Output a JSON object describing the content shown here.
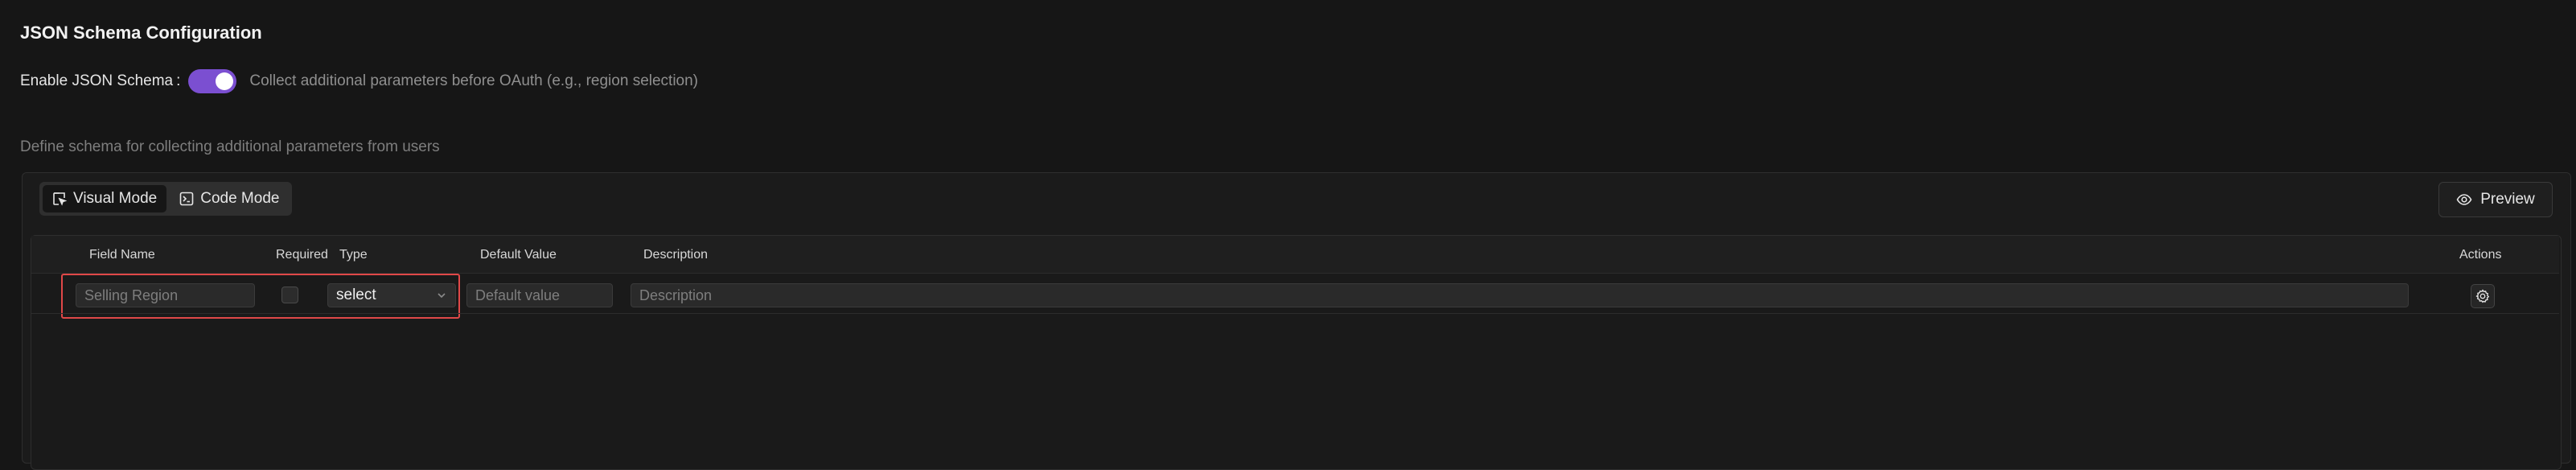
{
  "section": {
    "title": "JSON Schema Configuration",
    "enable_label": "Enable JSON Schema",
    "enable_colon": ":",
    "enable_on": true,
    "enable_help": "Collect additional parameters before OAuth (e.g., region selection)",
    "schema_help": "Define schema for collecting additional parameters from users"
  },
  "toolbar": {
    "tabs": [
      {
        "label": "Visual Mode",
        "icon": "cursor-select-icon",
        "active": true
      },
      {
        "label": "Code Mode",
        "icon": "terminal-icon",
        "active": false
      }
    ],
    "preview_label": "Preview",
    "preview_icon": "eye-icon"
  },
  "table": {
    "headers": {
      "field_name": "Field Name",
      "required": "Required",
      "type": "Type",
      "default_value": "Default Value",
      "description": "Description",
      "actions": "Actions"
    },
    "rows": [
      {
        "field_name_placeholder": "Selling Region",
        "required": false,
        "type": "select",
        "default_placeholder": "Default value",
        "description_placeholder": "Description",
        "action_icon": "gear-icon"
      }
    ]
  },
  "colors": {
    "accent": "#7b4fd1",
    "highlight": "#e04848",
    "background": "#161616"
  }
}
